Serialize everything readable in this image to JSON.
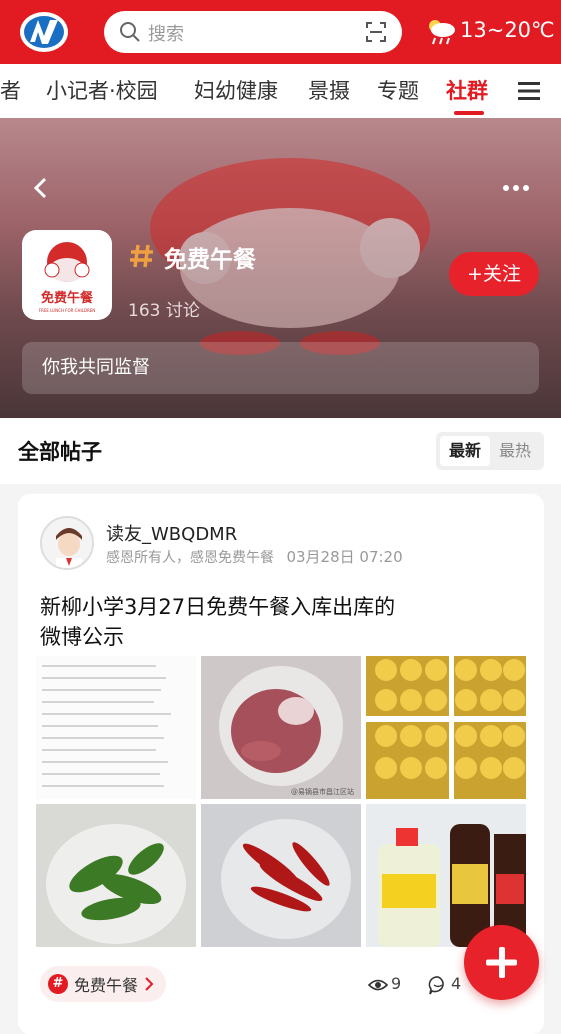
{
  "header": {
    "search_placeholder": "搜索",
    "weather_temp": "13~20℃",
    "brand_color": "#e21b22"
  },
  "channels": {
    "items": [
      {
        "label": "者",
        "active": false
      },
      {
        "label": "小记者·校园",
        "active": false
      },
      {
        "label": "妇幼健康",
        "active": false
      },
      {
        "label": "景摄",
        "active": false
      },
      {
        "label": "专题",
        "active": false
      },
      {
        "label": "社群",
        "active": true
      }
    ]
  },
  "topic": {
    "logo_text": "免费午餐",
    "logo_subtext": "FREE LUNCH FOR CHILDREN",
    "title": "免费午餐",
    "discussion_count": "163 讨论",
    "follow_label": "+关注",
    "slogan": "你我共同监督"
  },
  "posts_section": {
    "title": "全部帖子",
    "sort_options": [
      {
        "label": "最新",
        "selected": true
      },
      {
        "label": "最热",
        "selected": false
      }
    ]
  },
  "post": {
    "username": "读友_WBQDMR",
    "signature": "感恩所有人，感恩免费午餐",
    "date": "03月28日 07:20",
    "title": "新柳小学3月27日免费午餐入库出库的微博公示",
    "images": [
      "receipt-list",
      "pork-in-bag",
      "egg-trays",
      "green-peppers",
      "red-peppers",
      "cooking-wine-and-soy-sauce"
    ],
    "watermark": "@易镝县市昌江区站",
    "tag_label": "免费午餐",
    "views": "9",
    "comments": "4"
  }
}
